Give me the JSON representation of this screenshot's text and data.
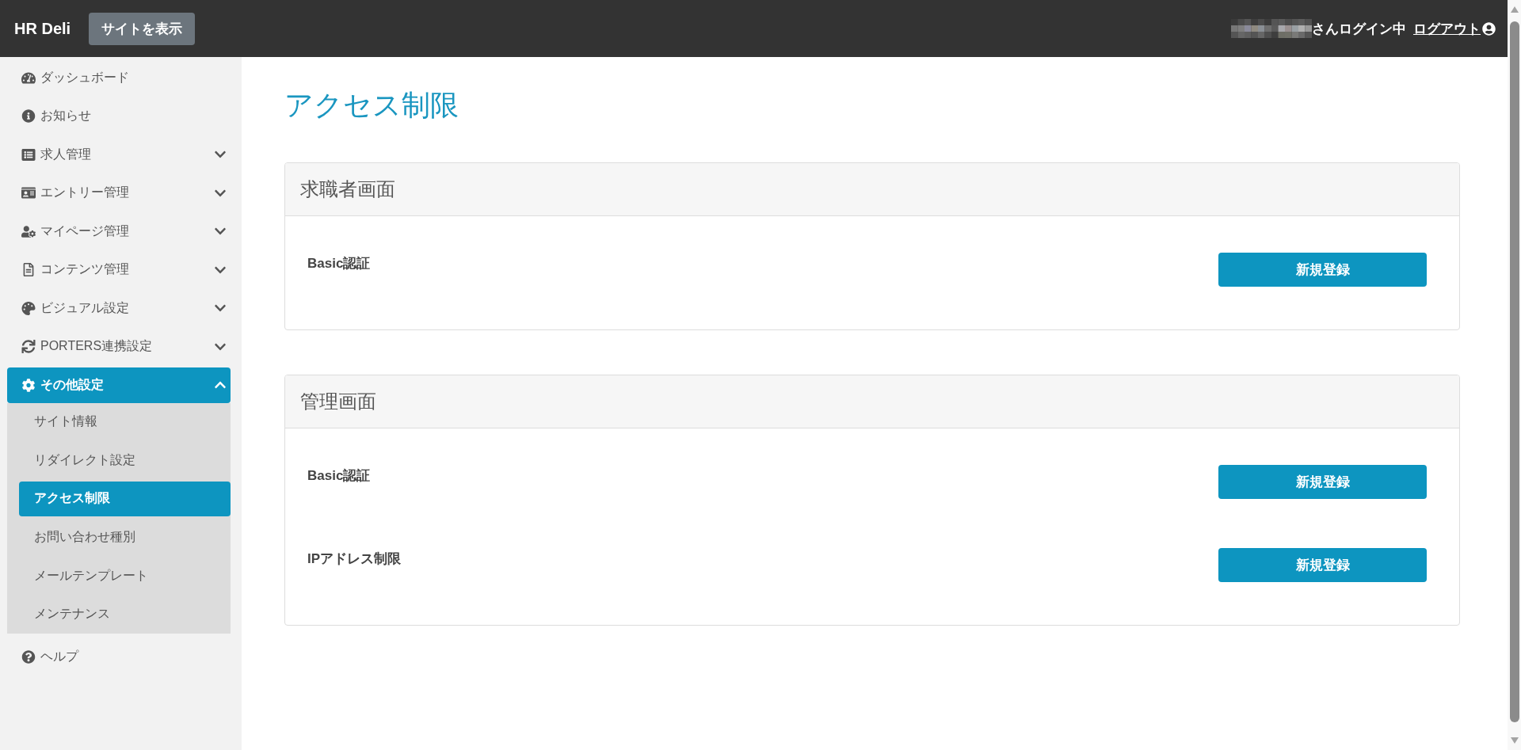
{
  "header": {
    "brand": "HR Deli",
    "site_button": "サイトを表示",
    "user_status": "さんログイン中",
    "logout_link": "ログアウト"
  },
  "sidebar": {
    "items": [
      {
        "kind": "link",
        "label": "ダッシュボード",
        "selected": false
      },
      {
        "kind": "link",
        "label": "お知らせ",
        "selected": false
      },
      {
        "kind": "group",
        "label": "求人管理",
        "selected": false,
        "expanded": false
      },
      {
        "kind": "group",
        "label": "エントリー管理",
        "selected": false,
        "expanded": false
      },
      {
        "kind": "group",
        "label": "マイページ管理",
        "selected": false,
        "expanded": false
      },
      {
        "kind": "group",
        "label": "コンテンツ管理",
        "selected": false,
        "expanded": false
      },
      {
        "kind": "group",
        "label": "ビジュアル設定",
        "selected": false,
        "expanded": false
      },
      {
        "kind": "group",
        "label": "PORTERS連携設定",
        "selected": false,
        "expanded": false
      },
      {
        "kind": "group",
        "label": "その他設定",
        "selected": true,
        "expanded": true,
        "children": [
          {
            "label": "サイト情報",
            "selected": false
          },
          {
            "label": "リダイレクト設定",
            "selected": false
          },
          {
            "label": "アクセス制限",
            "selected": true
          },
          {
            "label": "お問い合わせ種別",
            "selected": false
          },
          {
            "label": "メールテンプレート",
            "selected": false
          },
          {
            "label": "メンテナンス",
            "selected": false
          }
        ]
      },
      {
        "kind": "link",
        "label": "ヘルプ",
        "selected": false
      }
    ]
  },
  "page": {
    "title": "アクセス制限",
    "sections": [
      {
        "title": "求職者画面",
        "rows": [
          {
            "label": "Basic認証",
            "button": "新規登録"
          }
        ]
      },
      {
        "title": "管理画面",
        "rows": [
          {
            "label": "Basic認証",
            "button": "新規登録"
          },
          {
            "label": "IPアドレス制限",
            "button": "新規登録"
          }
        ]
      }
    ]
  }
}
